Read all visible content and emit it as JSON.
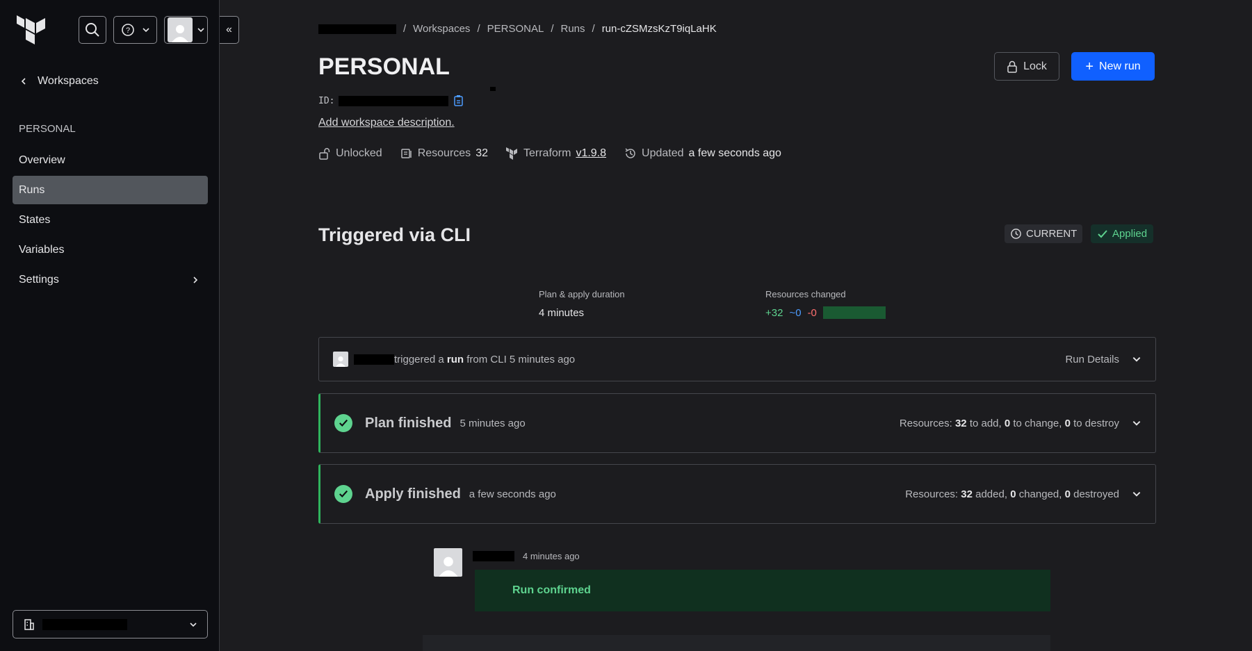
{
  "sidebar": {
    "back_label": "Workspaces",
    "workspace_name": "PERSONAL",
    "nav": [
      {
        "label": "Overview",
        "active": false
      },
      {
        "label": "Runs",
        "active": true
      },
      {
        "label": "States",
        "active": false
      },
      {
        "label": "Variables",
        "active": false
      },
      {
        "label": "Settings",
        "active": false
      }
    ]
  },
  "breadcrumb": {
    "items": [
      "Workspaces",
      "PERSONAL",
      "Runs"
    ],
    "current": "run-cZSMzsKzT9iqLaHK"
  },
  "workspace": {
    "title": "PERSONAL",
    "id_label": "ID:",
    "add_description": "Add workspace description.",
    "lock_status": "Unlocked",
    "resources_label": "Resources",
    "resources_count": "32",
    "terraform_label": "Terraform",
    "terraform_version": "v1.9.8",
    "updated_label": "Updated",
    "updated_value": "a few seconds ago"
  },
  "actions": {
    "lock_label": "Lock",
    "new_run_label": "New run"
  },
  "run": {
    "title": "Triggered via CLI",
    "current_badge": "CURRENT",
    "status_badge": "Applied",
    "duration_label": "Plan & apply duration",
    "duration_value": "4 minutes",
    "resources_changed_label": "Resources changed",
    "added": "+32",
    "changed": "~0",
    "destroyed": "-0",
    "trigger": {
      "text_a": "triggered a",
      "text_run": "run",
      "text_b": "from CLI 5 minutes ago",
      "details_label": "Run Details"
    },
    "plan": {
      "title": "Plan finished",
      "time": "5 minutes ago",
      "res_prefix": "Resources:",
      "add": "32",
      "add_suffix": "to add,",
      "change": "0",
      "change_suffix": "to change,",
      "destroy": "0",
      "destroy_suffix": "to destroy"
    },
    "apply": {
      "title": "Apply finished",
      "time": "a few seconds ago",
      "res_prefix": "Resources:",
      "add": "32",
      "add_suffix": "added,",
      "change": "0",
      "change_suffix": "changed,",
      "destroy": "0",
      "destroy_suffix": "destroyed"
    },
    "comment": {
      "time": "4 minutes ago",
      "message": "Run confirmed"
    }
  },
  "colors": {
    "accent": "#1060ff",
    "success": "#5ed38f",
    "sidebar_bg": "#0d0e12",
    "page_bg": "#1c1c1f"
  }
}
